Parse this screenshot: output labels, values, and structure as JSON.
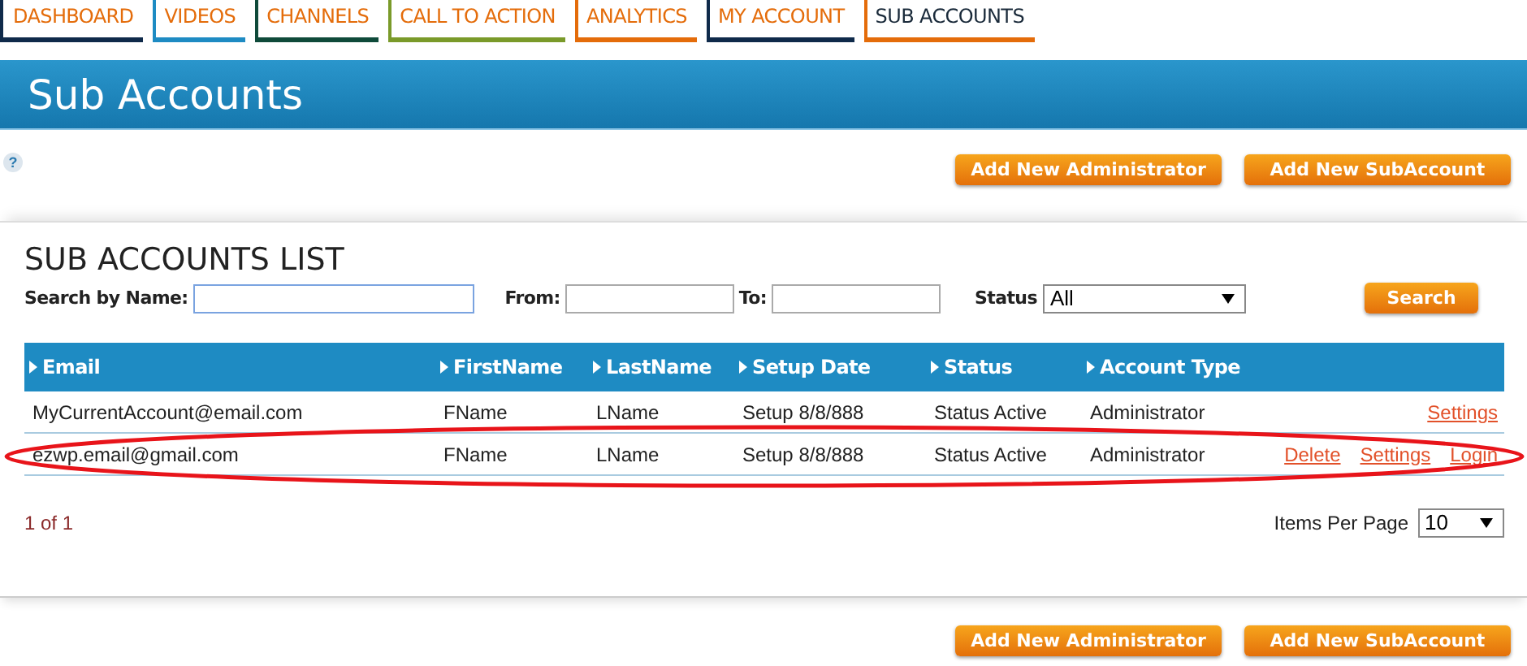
{
  "tabs": [
    {
      "label": "DASHBOARD",
      "color": "#0f2a4a",
      "selected": false
    },
    {
      "label": "VIDEOS",
      "color": "#1e8bc3",
      "selected": false
    },
    {
      "label": "CHANNELS",
      "color": "#0f4a3a",
      "selected": false
    },
    {
      "label": "CALL TO ACTION",
      "color": "#7a9a2a",
      "selected": false
    },
    {
      "label": "ANALYTICS",
      "color": "#e46c0a",
      "selected": false
    },
    {
      "label": "MY ACCOUNT",
      "color": "#0f2a4a",
      "selected": false
    },
    {
      "label": "SUB ACCOUNTS",
      "color": "#e46c0a",
      "selected": true
    }
  ],
  "header": {
    "title": "Sub Accounts"
  },
  "help": "?",
  "top_buttons": [
    "Add New Administrator",
    "Add New SubAccount"
  ],
  "list": {
    "title": "SUB ACCOUNTS LIST",
    "search": {
      "name_label": "Search by Name:",
      "from_label": "From:",
      "to_label": "To:",
      "status_label": "Status",
      "status_value": "All",
      "button": "Search"
    },
    "table": {
      "columns": [
        "Email",
        "FirstName",
        "LastName",
        "Setup Date",
        "Status",
        "Account Type"
      ],
      "rows": [
        {
          "cells": [
            "MyCurrentAccount@email.com",
            "FName",
            "LName",
            "Setup 8/8/888",
            "Status Active",
            "Administrator"
          ],
          "actions": [
            "Settings"
          ],
          "highlighted": false
        },
        {
          "cells": [
            "ezwp.email@gmail.com",
            "FName",
            "LName",
            "Setup 8/8/888",
            "Status Active",
            "Administrator"
          ],
          "actions": [
            "Delete",
            "Settings",
            "Login"
          ],
          "highlighted": true
        }
      ]
    },
    "pagination": "1 of 1",
    "items_per_page": {
      "label": "Items Per Page",
      "value": "10"
    }
  },
  "bottom_buttons": [
    "Add New Administrator",
    "Add New SubAccount"
  ]
}
